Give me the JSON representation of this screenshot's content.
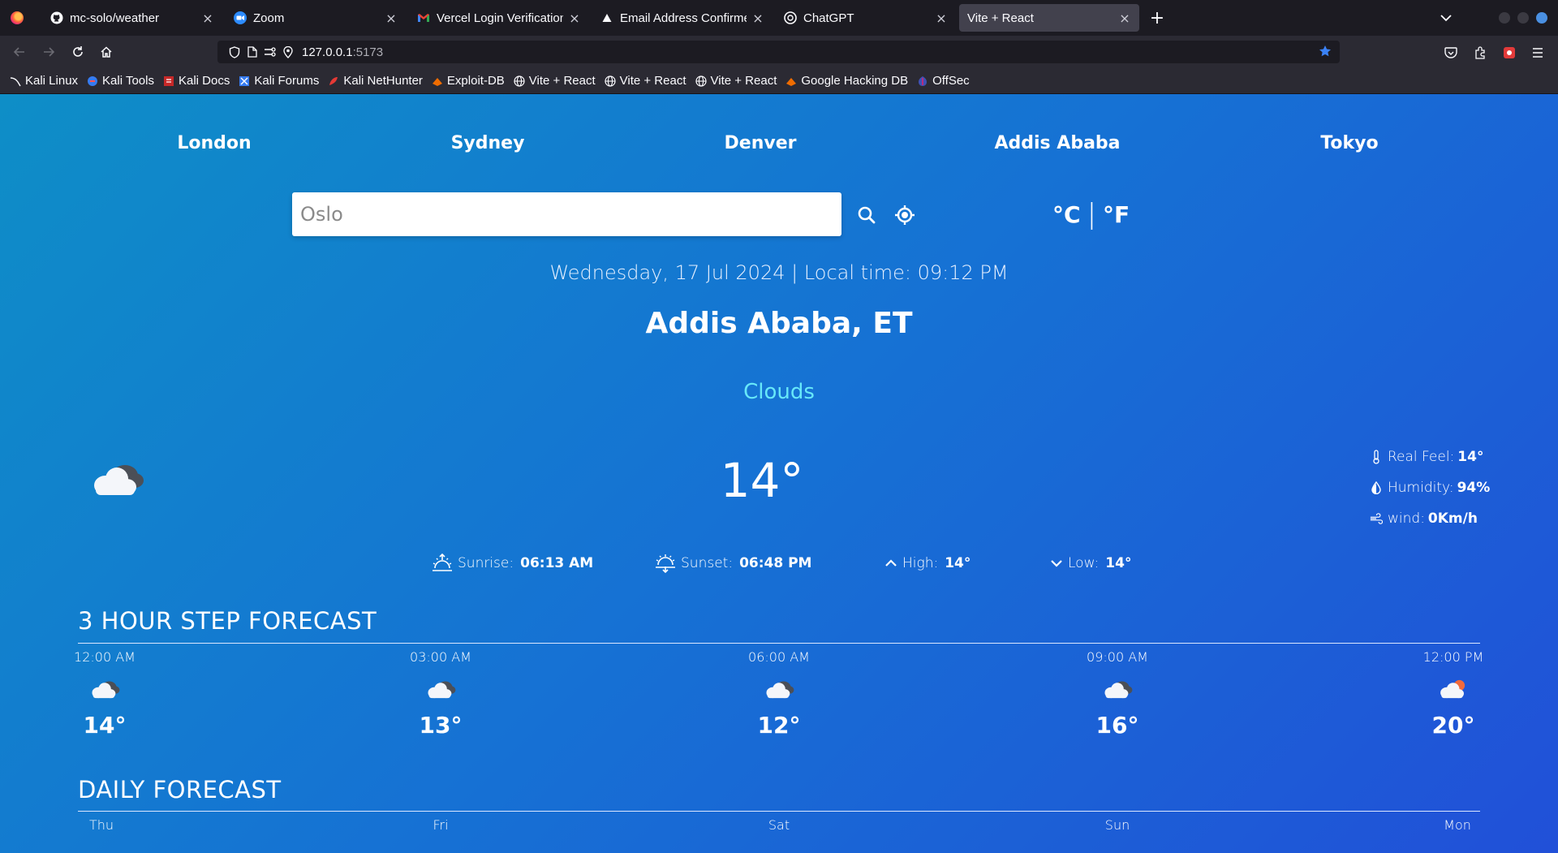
{
  "browser": {
    "tabs": [
      {
        "title": "mc-solo/weather",
        "icon": "github-icon",
        "active": false
      },
      {
        "title": "Zoom",
        "icon": "zoom-icon",
        "active": false
      },
      {
        "title": "Vercel Login Verification",
        "icon": "gmail-icon",
        "active": false
      },
      {
        "title": "Email Address Confirmed",
        "icon": "vercel-icon",
        "active": false
      },
      {
        "title": "ChatGPT",
        "icon": "chatgpt-icon",
        "active": false
      },
      {
        "title": "Vite + React",
        "icon": "",
        "active": true
      }
    ],
    "url_host": "127.0.0.1",
    "url_port": ":5173",
    "bookmarks": [
      {
        "label": "Kali Linux",
        "icon": "kali-icon"
      },
      {
        "label": "Kali Tools",
        "icon": "kali-tools-icon"
      },
      {
        "label": "Kali Docs",
        "icon": "kali-docs-icon"
      },
      {
        "label": "Kali Forums",
        "icon": "kali-forums-icon"
      },
      {
        "label": "Kali NetHunter",
        "icon": "nethunter-icon"
      },
      {
        "label": "Exploit-DB",
        "icon": "exploit-db-icon"
      },
      {
        "label": "Vite + React",
        "icon": "globe-icon"
      },
      {
        "label": "Vite + React",
        "icon": "globe-icon"
      },
      {
        "label": "Vite + React",
        "icon": "globe-icon"
      },
      {
        "label": "Google Hacking DB",
        "icon": "ghdb-icon"
      },
      {
        "label": "OffSec",
        "icon": "offsec-icon"
      }
    ]
  },
  "app": {
    "cities": [
      "London",
      "Sydney",
      "Denver",
      "Addis Ababa",
      "Tokyo"
    ],
    "search": {
      "placeholder": "Oslo",
      "value": ""
    },
    "units": {
      "celsius": "°C",
      "separator": "|",
      "fahrenheit": "°F"
    },
    "datetime": "Wednesday, 17 Jul 2024 | Local time: 09:12 PM",
    "location": "Addis Ababa, ET",
    "condition": "Clouds",
    "temperature": "14°",
    "details": {
      "real_feel": {
        "label": "Real Feel:",
        "value": "14°"
      },
      "humidity": {
        "label": "Humidity:",
        "value": "94%"
      },
      "wind": {
        "label": "wind:",
        "value": "0Km/h"
      }
    },
    "sun": {
      "sunrise": {
        "label": "Sunrise:",
        "value": "06:13 AM"
      },
      "sunset": {
        "label": "Sunset:",
        "value": "06:48 PM"
      },
      "high": {
        "label": "High:",
        "value": "14°"
      },
      "low": {
        "label": "Low:",
        "value": "14°"
      }
    },
    "hourly": {
      "title": "3 hour step forecast",
      "items": [
        {
          "time": "12:00 AM",
          "temp": "14°",
          "icon": "cloudy-night-icon"
        },
        {
          "time": "03:00 AM",
          "temp": "13°",
          "icon": "cloudy-night-icon"
        },
        {
          "time": "06:00 AM",
          "temp": "12°",
          "icon": "cloudy-night-icon"
        },
        {
          "time": "09:00 AM",
          "temp": "16°",
          "icon": "cloudy-night-icon"
        },
        {
          "time": "12:00 PM",
          "temp": "20°",
          "icon": "cloudy-day-icon"
        }
      ]
    },
    "daily": {
      "title": "daily forecast",
      "items": [
        {
          "day": "Thu"
        },
        {
          "day": "Fri"
        },
        {
          "day": "Sat"
        },
        {
          "day": "Sun"
        },
        {
          "day": "Mon"
        }
      ]
    }
  }
}
